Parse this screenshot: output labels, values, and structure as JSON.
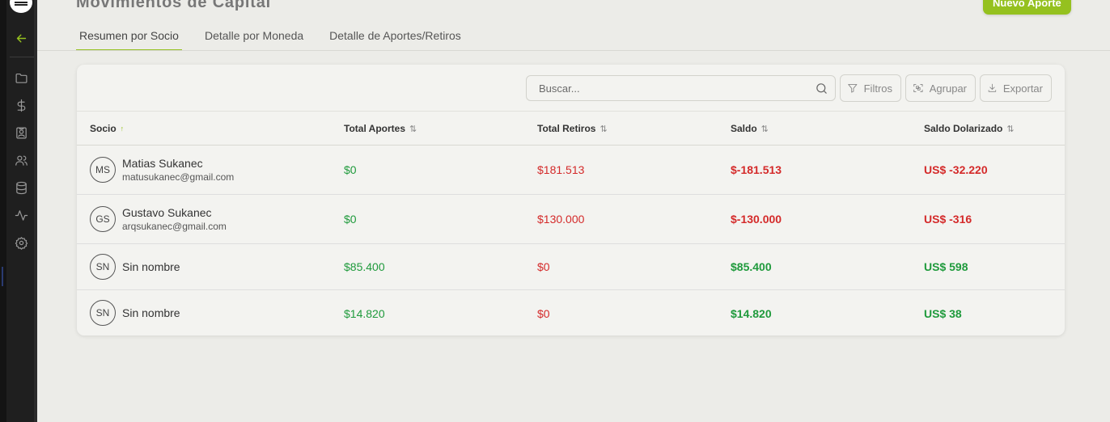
{
  "page": {
    "title": "Movimientos de Capital",
    "new_button": "Nuevo Aporte"
  },
  "sidebar": {
    "icons": [
      "arrow-left-icon",
      "folder-icon",
      "dollar-icon",
      "id-card-icon",
      "users-icon",
      "database-icon",
      "activity-icon",
      "gear-icon"
    ]
  },
  "tabs": [
    {
      "label": "Resumen por Socio",
      "active": true
    },
    {
      "label": "Detalle por Moneda",
      "active": false
    },
    {
      "label": "Detalle de Aportes/Retiros",
      "active": false
    }
  ],
  "toolbar": {
    "search_placeholder": "Buscar...",
    "filters": "Filtros",
    "group": "Agrupar",
    "export": "Exportar"
  },
  "table": {
    "columns": [
      {
        "label": "Socio",
        "sort": "↑"
      },
      {
        "label": "Total Aportes",
        "sort": "⇅"
      },
      {
        "label": "Total Retiros",
        "sort": "⇅"
      },
      {
        "label": "Saldo",
        "sort": "⇅"
      },
      {
        "label": "Saldo Dolarizado",
        "sort": "⇅"
      }
    ],
    "rows": [
      {
        "initials": "MS",
        "name": "Matias Sukanec",
        "email": "matusukanec@gmail.com",
        "aportes": "$0",
        "retiros": "$181.513",
        "saldo": "$-181.513",
        "saldo_usd": "US$ -32.220"
      },
      {
        "initials": "GS",
        "name": "Gustavo Sukanec",
        "email": "arqsukanec@gmail.com",
        "aportes": "$0",
        "retiros": "$130.000",
        "saldo": "$-130.000",
        "saldo_usd": "US$ -316"
      },
      {
        "initials": "SN",
        "name": "Sin nombre",
        "email": "",
        "aportes": "$85.400",
        "retiros": "$0",
        "saldo": "$85.400",
        "saldo_usd": "US$ 598"
      },
      {
        "initials": "SN",
        "name": "Sin nombre",
        "email": "",
        "aportes": "$14.820",
        "retiros": "$0",
        "saldo": "$14.820",
        "saldo_usd": "US$ 38"
      }
    ]
  },
  "colors": {
    "accent": "#95c11f",
    "positive": "#1f9a3c",
    "negative": "#d42a2a",
    "sidebar_bg": "#1f1f1f",
    "page_bg": "#ecece8"
  }
}
